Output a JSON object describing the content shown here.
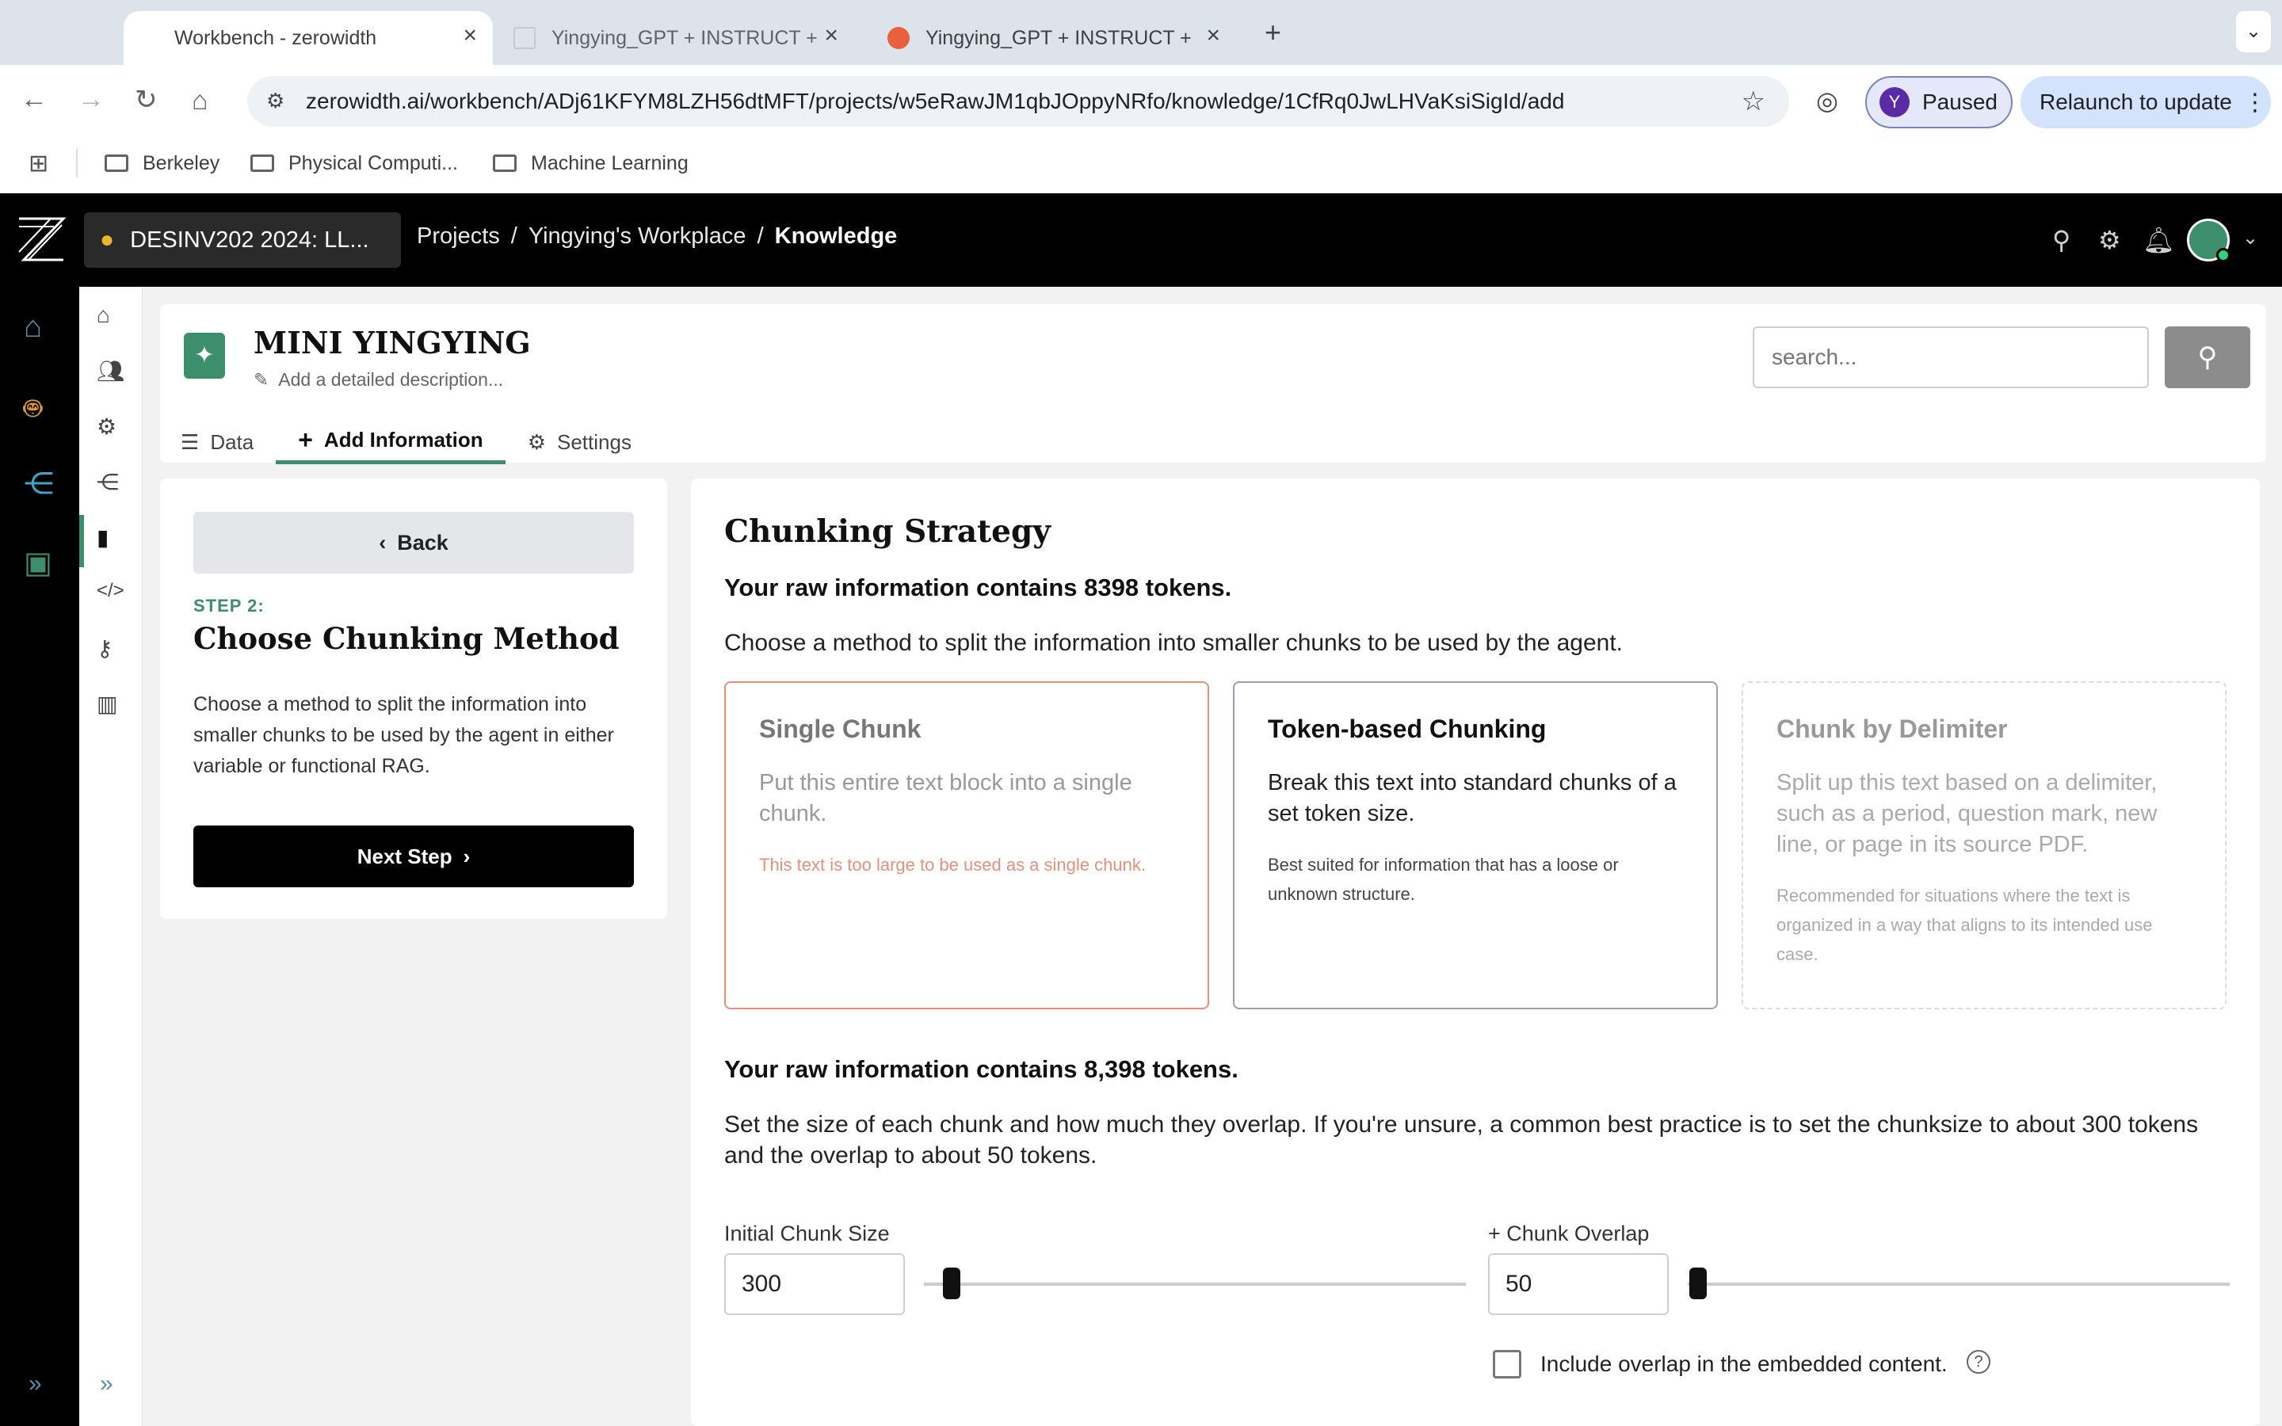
{
  "browser": {
    "tabs": [
      {
        "title": "Workbench - zerowidth"
      },
      {
        "title": "Yingying_GPT + INSTRUCT +"
      },
      {
        "title": "Yingying_GPT + INSTRUCT +"
      }
    ],
    "url": "zerowidth.ai/workbench/ADj61KFYM8LZH56dtMFT/projects/w5eRawJM1qbJOppyNRfo/knowledge/1CfRq0JwLHVaKsiSigId/add",
    "profile_initial": "Y",
    "profile_status": "Paused",
    "relaunch_label": "Relaunch to update",
    "bookmarks": [
      "Berkeley",
      "Physical Computi...",
      "Machine Learning"
    ]
  },
  "header": {
    "org_name": "DESINV202 2024: LL...",
    "breadcrumbs": [
      "Projects",
      "/",
      "Yingying's Workplace",
      "/",
      "Knowledge"
    ]
  },
  "knowledge": {
    "title": "MINI YINGYING",
    "description_placeholder": "Add a detailed description...",
    "search_placeholder": "search...",
    "tabs": [
      "Data",
      "Add Information",
      "Settings"
    ]
  },
  "step": {
    "back_label": "Back",
    "label": "STEP 2:",
    "title": "Choose Chunking Method",
    "description": "Choose a method to split the information into smaller chunks to be used by the agent in either variable or functional RAG.",
    "next_label": "Next Step"
  },
  "strategy": {
    "title": "Chunking Strategy",
    "token_summary": "Your raw information contains 8398 tokens.",
    "instructions": "Choose a method to split the information into smaller chunks to be used by the agent.",
    "options": [
      {
        "title": "Single Chunk",
        "description": "Put this entire text block into a single chunk.",
        "note": "This text is too large to be used as a single chunk."
      },
      {
        "title": "Token-based Chunking",
        "description": "Break this text into standard chunks of a set token size.",
        "note": "Best suited for information that has a loose or unknown structure."
      },
      {
        "title": "Chunk by Delimiter",
        "description": "Split up this text based on a delimiter, such as a period, question mark, new line, or page in its source PDF.",
        "note": "Recommended for situations where the text is organized in a way that aligns to its intended use case."
      }
    ],
    "token_summary_2": "Your raw information contains 8,398 tokens.",
    "size_instructions": "Set the size of each chunk and how much they overlap. If you're unsure, a common best practice is to set the chunksize to about 300 tokens and the overlap to about 50 tokens.",
    "chunk_size_label": "Initial Chunk Size",
    "chunk_size_value": "300",
    "overlap_label": "+ Chunk Overlap",
    "overlap_value": "50",
    "include_overlap_label": "Include overlap in the embedded content.",
    "include_overlap_checked": false
  },
  "colors": {
    "accent_green": "#3d8f6c",
    "warning": "#e88f7c",
    "header_bg": "#000000"
  }
}
